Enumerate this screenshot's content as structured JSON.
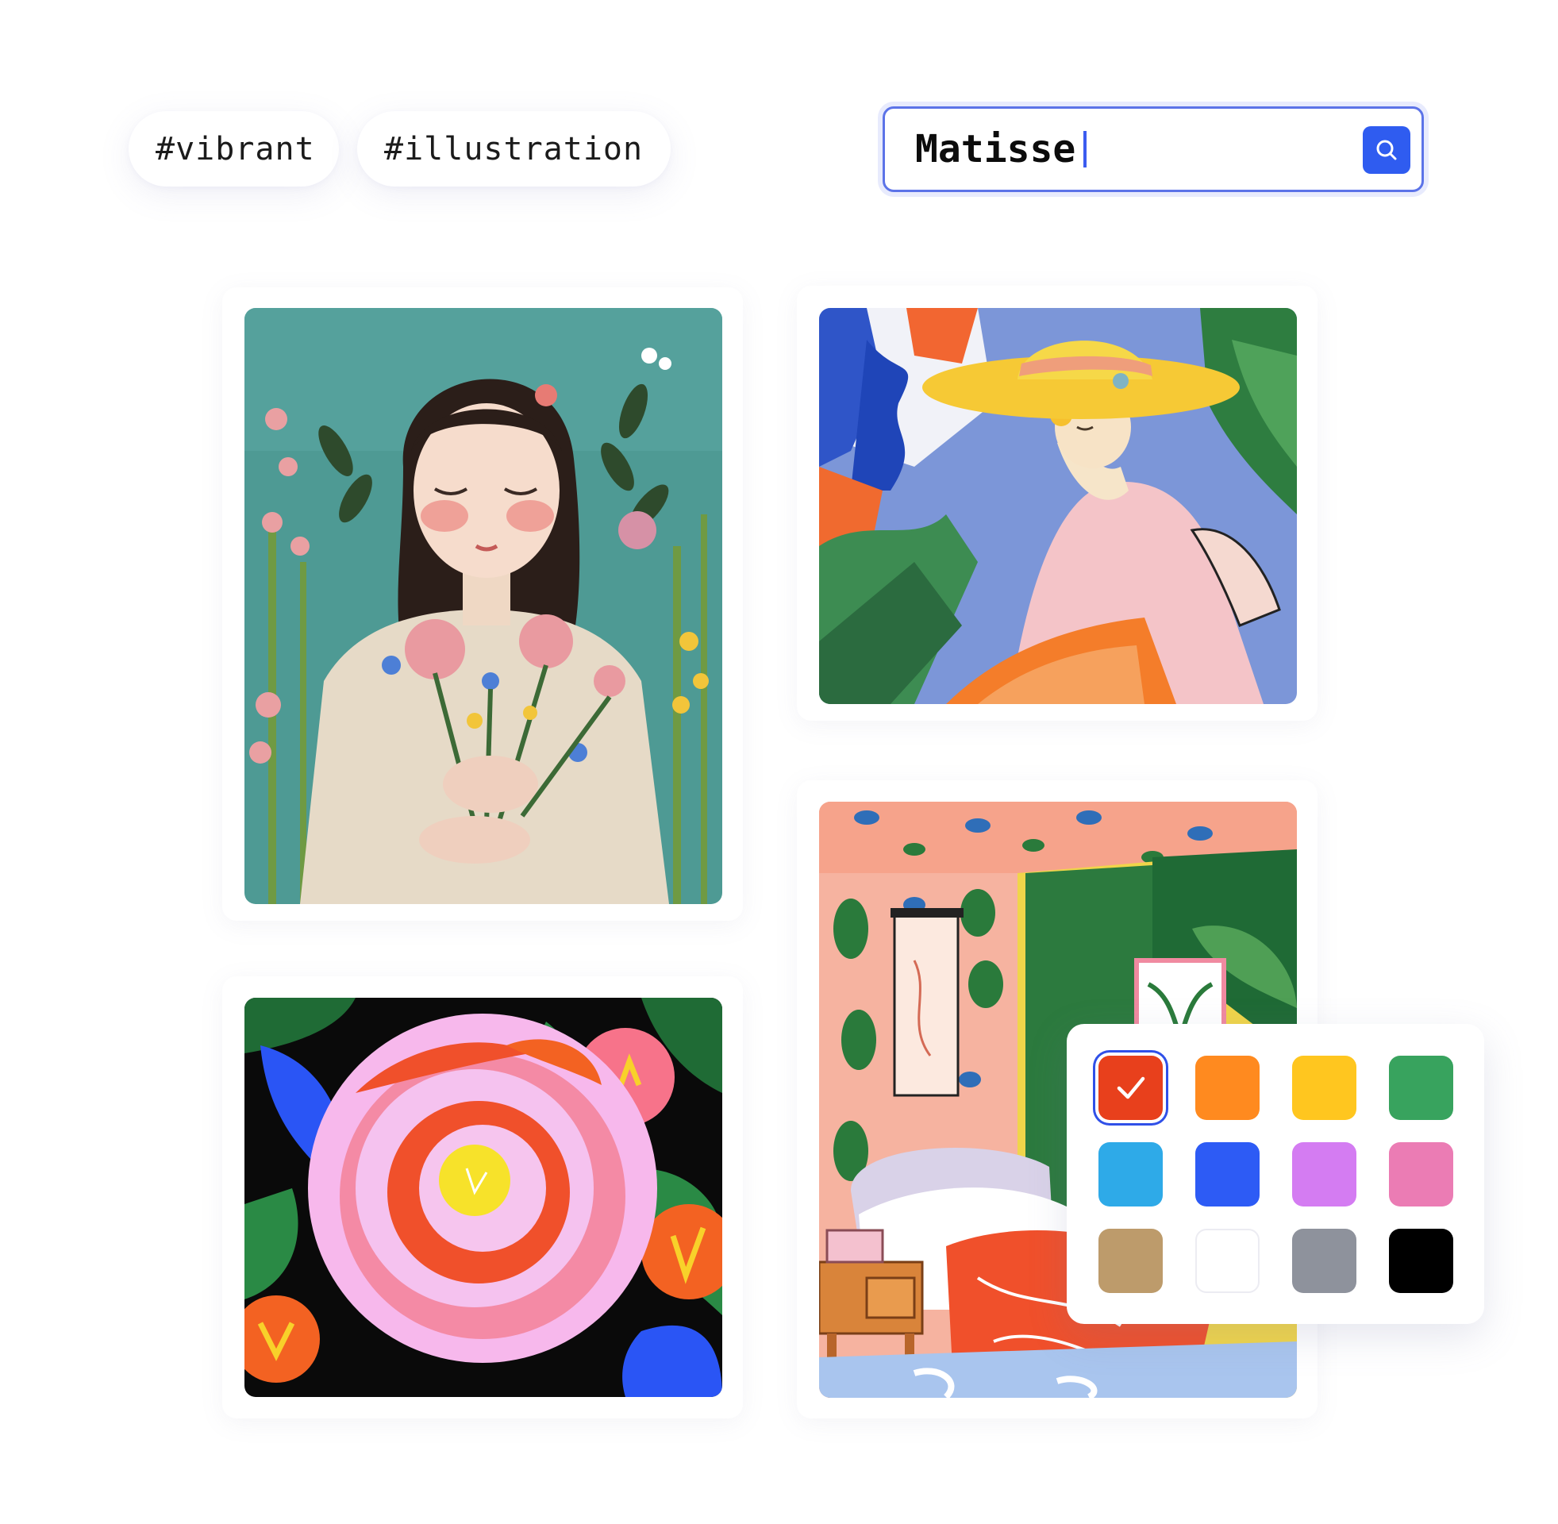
{
  "tags": [
    "#vibrant",
    "#illustration"
  ],
  "search": {
    "value": "Matisse",
    "icon": "search-icon"
  },
  "images": [
    {
      "id": "girl-with-flowers",
      "icon": "image"
    },
    {
      "id": "woman-in-yellow-hat",
      "icon": "image"
    },
    {
      "id": "bold-flower",
      "icon": "image"
    },
    {
      "id": "bedroom-interior",
      "icon": "image"
    }
  ],
  "palette": {
    "selected_index": 0,
    "colors": [
      {
        "name": "red",
        "hex": "#E8401C"
      },
      {
        "name": "orange",
        "hex": "#FF8A1F"
      },
      {
        "name": "yellow",
        "hex": "#FFC61F"
      },
      {
        "name": "green",
        "hex": "#38A35E"
      },
      {
        "name": "light-blue",
        "hex": "#2EAAE8"
      },
      {
        "name": "blue",
        "hex": "#2D5BF5"
      },
      {
        "name": "purple",
        "hex": "#D47CF2"
      },
      {
        "name": "pink",
        "hex": "#EB7CB4"
      },
      {
        "name": "tan",
        "hex": "#BD9B6B"
      },
      {
        "name": "white",
        "hex": "#FFFFFF"
      },
      {
        "name": "gray",
        "hex": "#8E929C"
      },
      {
        "name": "black",
        "hex": "#000000"
      }
    ]
  }
}
